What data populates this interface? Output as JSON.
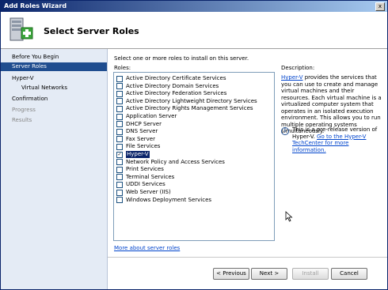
{
  "window": {
    "title": "Add Roles Wizard",
    "close_glyph": "x"
  },
  "header": {
    "title": "Select Server Roles",
    "icon": "server-roles-icon"
  },
  "nav": {
    "items": [
      {
        "label": "Before You Begin",
        "state": "normal"
      },
      {
        "label": "Server Roles",
        "state": "selected"
      },
      {
        "label": "Hyper-V",
        "state": "normal"
      },
      {
        "label": "Virtual Networks",
        "state": "sub"
      },
      {
        "label": "Confirmation",
        "state": "normal"
      },
      {
        "label": "Progress",
        "state": "disabled"
      },
      {
        "label": "Results",
        "state": "disabled"
      }
    ]
  },
  "main": {
    "intro": "Select one or more roles to install on this server.",
    "roles_label": "Roles:",
    "roles": [
      {
        "label": "Active Directory Certificate Services",
        "checked": false
      },
      {
        "label": "Active Directory Domain Services",
        "checked": false
      },
      {
        "label": "Active Directory Federation Services",
        "checked": false
      },
      {
        "label": "Active Directory Lightweight Directory Services",
        "checked": false
      },
      {
        "label": "Active Directory Rights Management Services",
        "checked": false
      },
      {
        "label": "Application Server",
        "checked": false
      },
      {
        "label": "DHCP Server",
        "checked": false
      },
      {
        "label": "DNS Server",
        "checked": false
      },
      {
        "label": "Fax Server",
        "checked": false
      },
      {
        "label": "File Services",
        "checked": false
      },
      {
        "label": "Hyper-V",
        "checked": true
      },
      {
        "label": "Network Policy and Access Services",
        "checked": false
      },
      {
        "label": "Print Services",
        "checked": false
      },
      {
        "label": "Terminal Services",
        "checked": false
      },
      {
        "label": "UDDI Services",
        "checked": false
      },
      {
        "label": "Web Server (IIS)",
        "checked": false
      },
      {
        "label": "Windows Deployment Services",
        "checked": false
      }
    ],
    "description": {
      "title": "Description:",
      "link": "Hyper-V",
      "text": " provides the services that you can use to create and manage virtual machines and their resources. Each virtual machine is a virtualized computer system that operates in an isolated execution environment. This allows you to run multiple operating systems simultaneously."
    },
    "info": {
      "text": "This is a pre-release version of Hyper-V. ",
      "link": "Go to the Hyper-V TechCenter for more information."
    },
    "more_link": "More about server roles"
  },
  "buttons": {
    "previous": "< Previous",
    "next": "Next >",
    "install": "Install",
    "cancel": "Cancel"
  },
  "colors": {
    "nav_selected": "#1f4d8f",
    "nav_bg": "#e4ebf5",
    "link": "#0044cc"
  }
}
